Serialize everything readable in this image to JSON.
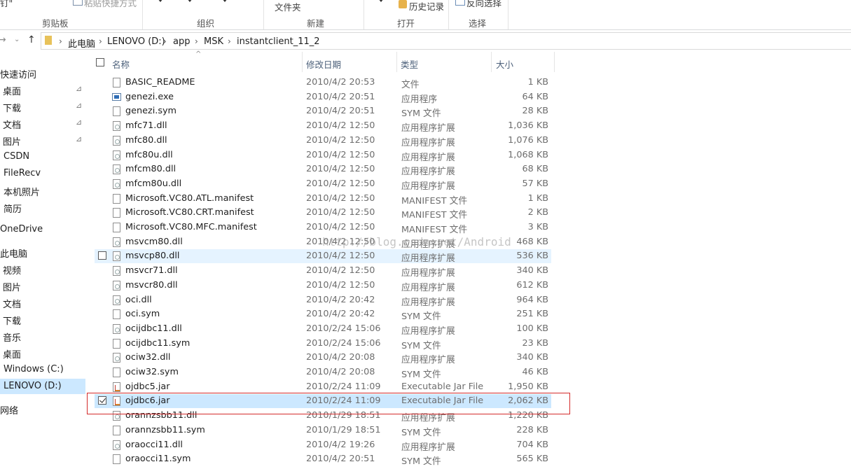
{
  "ribbon": {
    "clipboard_partial": "钉\"",
    "paste_shortcut": "粘贴快捷方式",
    "new_folder_partial": "文件夹",
    "history": "历史记录",
    "invert_select": "反向选择",
    "groups": [
      "剪贴板",
      "组织",
      "新建",
      "打开",
      "选择"
    ]
  },
  "address": {
    "crumbs": [
      "此电脑",
      "LENOVO (D:)",
      "app",
      "MSK",
      "instantclient_11_2"
    ]
  },
  "sidebar": {
    "items": [
      {
        "label": "快速访问",
        "pinned": false
      },
      {
        "label": "桌面",
        "pinned": true
      },
      {
        "label": "下载",
        "pinned": true
      },
      {
        "label": "文档",
        "pinned": true
      },
      {
        "label": "图片",
        "pinned": true
      },
      {
        "label": "CSDN",
        "pinned": false
      },
      {
        "label": "FileRecv",
        "pinned": false
      },
      {
        "label": "本机照片",
        "pinned": false
      },
      {
        "label": "简历",
        "pinned": false
      },
      {
        "label": "OneDrive",
        "pinned": false
      },
      {
        "label": "此电脑",
        "pinned": false
      },
      {
        "label": "视频",
        "pinned": false
      },
      {
        "label": "图片",
        "pinned": false
      },
      {
        "label": "文档",
        "pinned": false
      },
      {
        "label": "下载",
        "pinned": false
      },
      {
        "label": "音乐",
        "pinned": false
      },
      {
        "label": "桌面",
        "pinned": false
      },
      {
        "label": "Windows (C:)",
        "pinned": false
      },
      {
        "label": "LENOVO (D:)",
        "pinned": false
      },
      {
        "label": "网络",
        "pinned": false
      }
    ],
    "selected_index": 18,
    "pin_glyph": "📌"
  },
  "columns": {
    "name": "名称",
    "date": "修改日期",
    "type": "类型",
    "size": "大小"
  },
  "files": [
    {
      "name": "BASIC_README",
      "date": "2010/4/2 20:53",
      "type": "文件",
      "size": "1 KB",
      "icon": "file-icon"
    },
    {
      "name": "genezi.exe",
      "date": "2010/4/2 20:51",
      "type": "应用程序",
      "size": "64 KB",
      "icon": "exe-icon"
    },
    {
      "name": "genezi.sym",
      "date": "2010/4/2 20:51",
      "type": "SYM 文件",
      "size": "28 KB",
      "icon": "file-icon"
    },
    {
      "name": "mfc71.dll",
      "date": "2010/4/2 12:50",
      "type": "应用程序扩展",
      "size": "1,036 KB",
      "icon": "dll-icon"
    },
    {
      "name": "mfc80.dll",
      "date": "2010/4/2 12:50",
      "type": "应用程序扩展",
      "size": "1,076 KB",
      "icon": "dll-icon"
    },
    {
      "name": "mfc80u.dll",
      "date": "2010/4/2 12:50",
      "type": "应用程序扩展",
      "size": "1,068 KB",
      "icon": "dll-icon"
    },
    {
      "name": "mfcm80.dll",
      "date": "2010/4/2 12:50",
      "type": "应用程序扩展",
      "size": "68 KB",
      "icon": "dll-icon"
    },
    {
      "name": "mfcm80u.dll",
      "date": "2010/4/2 12:50",
      "type": "应用程序扩展",
      "size": "57 KB",
      "icon": "dll-icon"
    },
    {
      "name": "Microsoft.VC80.ATL.manifest",
      "date": "2010/4/2 12:50",
      "type": "MANIFEST 文件",
      "size": "1 KB",
      "icon": "file-icon"
    },
    {
      "name": "Microsoft.VC80.CRT.manifest",
      "date": "2010/4/2 12:50",
      "type": "MANIFEST 文件",
      "size": "2 KB",
      "icon": "file-icon"
    },
    {
      "name": "Microsoft.VC80.MFC.manifest",
      "date": "2010/4/2 12:50",
      "type": "MANIFEST 文件",
      "size": "3 KB",
      "icon": "file-icon"
    },
    {
      "name": "msvcm80.dll",
      "date": "2010/4/2 12:50",
      "type": "应用程序扩展",
      "size": "468 KB",
      "icon": "dll-icon"
    },
    {
      "name": "msvcp80.dll",
      "date": "2010/4/2 12:50",
      "type": "应用程序扩展",
      "size": "536 KB",
      "icon": "dll-icon",
      "state": "hover"
    },
    {
      "name": "msvcr71.dll",
      "date": "2010/4/2 12:50",
      "type": "应用程序扩展",
      "size": "340 KB",
      "icon": "dll-icon"
    },
    {
      "name": "msvcr80.dll",
      "date": "2010/4/2 12:50",
      "type": "应用程序扩展",
      "size": "612 KB",
      "icon": "dll-icon"
    },
    {
      "name": "oci.dll",
      "date": "2010/4/2 20:42",
      "type": "应用程序扩展",
      "size": "964 KB",
      "icon": "dll-icon"
    },
    {
      "name": "oci.sym",
      "date": "2010/4/2 20:42",
      "type": "SYM 文件",
      "size": "251 KB",
      "icon": "file-icon"
    },
    {
      "name": "ocijdbc11.dll",
      "date": "2010/2/24 15:06",
      "type": "应用程序扩展",
      "size": "100 KB",
      "icon": "dll-icon"
    },
    {
      "name": "ocijdbc11.sym",
      "date": "2010/2/24 15:06",
      "type": "SYM 文件",
      "size": "23 KB",
      "icon": "file-icon"
    },
    {
      "name": "ociw32.dll",
      "date": "2010/4/2 20:08",
      "type": "应用程序扩展",
      "size": "340 KB",
      "icon": "dll-icon"
    },
    {
      "name": "ociw32.sym",
      "date": "2010/4/2 20:08",
      "type": "SYM 文件",
      "size": "46 KB",
      "icon": "file-icon"
    },
    {
      "name": "ojdbc5.jar",
      "date": "2010/2/24 11:09",
      "type": "Executable Jar File",
      "size": "1,950 KB",
      "icon": "jar-icon"
    },
    {
      "name": "ojdbc6.jar",
      "date": "2010/2/24 11:09",
      "type": "Executable Jar File",
      "size": "2,062 KB",
      "icon": "jar-icon",
      "state": "selected"
    },
    {
      "name": "orannzsbb11.dll",
      "date": "2010/1/29 18:51",
      "type": "应用程序扩展",
      "size": "1,220 KB",
      "icon": "dll-icon"
    },
    {
      "name": "orannzsbb11.sym",
      "date": "2010/1/29 18:51",
      "type": "SYM 文件",
      "size": "228 KB",
      "icon": "file-icon"
    },
    {
      "name": "oraocci11.dll",
      "date": "2010/4/2 19:26",
      "type": "应用程序扩展",
      "size": "704 KB",
      "icon": "dll-icon"
    },
    {
      "name": "oraocci11.sym",
      "date": "2010/4/2 20:51",
      "type": "SYM 文件",
      "size": "565 KB",
      "icon": "file-icon"
    }
  ],
  "watermark": "http://blog.csdn.net/Android",
  "colors": {
    "selected_row": "#cce8ff",
    "hover_row": "#e5f3ff",
    "highlight_box": "#d42a2a"
  }
}
